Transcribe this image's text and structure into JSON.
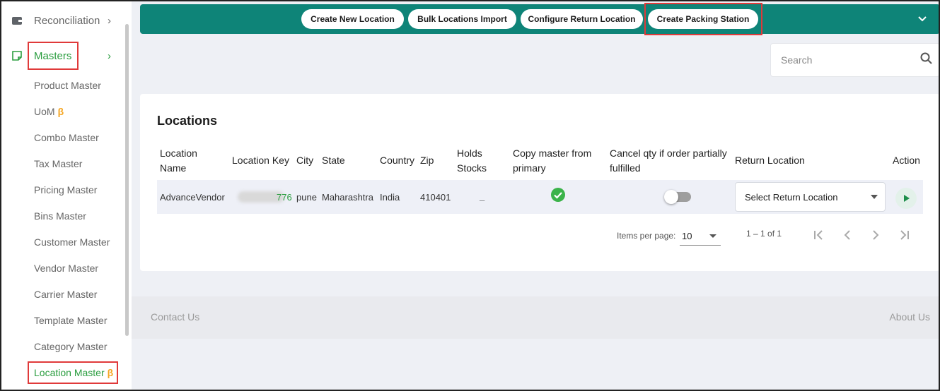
{
  "sidebar": {
    "reconciliation": "Reconciliation",
    "masters": "Masters",
    "items": [
      {
        "label": "Product Master"
      },
      {
        "label": "UoM",
        "beta": "β"
      },
      {
        "label": "Combo Master"
      },
      {
        "label": "Tax Master"
      },
      {
        "label": "Pricing Master"
      },
      {
        "label": "Bins Master"
      },
      {
        "label": "Customer Master"
      },
      {
        "label": "Vendor Master"
      },
      {
        "label": "Carrier Master"
      },
      {
        "label": "Template Master"
      },
      {
        "label": "Category Master"
      },
      {
        "label": "Location Master",
        "beta": "β"
      }
    ]
  },
  "toolbar": {
    "create_new_location": "Create New Location",
    "bulk_import": "Bulk Locations Import",
    "configure_return": "Configure Return Location",
    "create_packing": "Create Packing Station"
  },
  "search": {
    "placeholder": "Search"
  },
  "card": {
    "title": "Locations"
  },
  "table": {
    "headers": {
      "location_name": [
        "Location",
        "Name"
      ],
      "location_key": "Location Key",
      "city": "City",
      "state": "State",
      "country": "Country",
      "zip": "Zip",
      "holds_stocks": [
        "Holds",
        "Stocks"
      ],
      "copy_master": [
        "Copy master from",
        "primary"
      ],
      "cancel_qty": [
        "Cancel qty if order partially",
        "fulfilled"
      ],
      "return_location": "Return Location",
      "action": "Action"
    },
    "rows": [
      {
        "location_name": "AdvanceVendor",
        "location_key_suffix": "776",
        "city": "pune",
        "state": "Maharashtra",
        "country": "India",
        "zip": "410401",
        "holds_stocks": "_",
        "copy_master": true,
        "cancel_qty": false,
        "return_location_placeholder": "Select Return Location"
      }
    ]
  },
  "pagination": {
    "items_per_page_label": "Items per page:",
    "items_per_page": "10",
    "range": "1 – 1 of 1"
  },
  "footer": {
    "contact": "Contact Us",
    "about": "About Us"
  },
  "colors": {
    "accent": "#0e8478",
    "masters_green": "#2a9d3f",
    "highlight_box": "#e03a3a",
    "beta": "#f5a623"
  }
}
